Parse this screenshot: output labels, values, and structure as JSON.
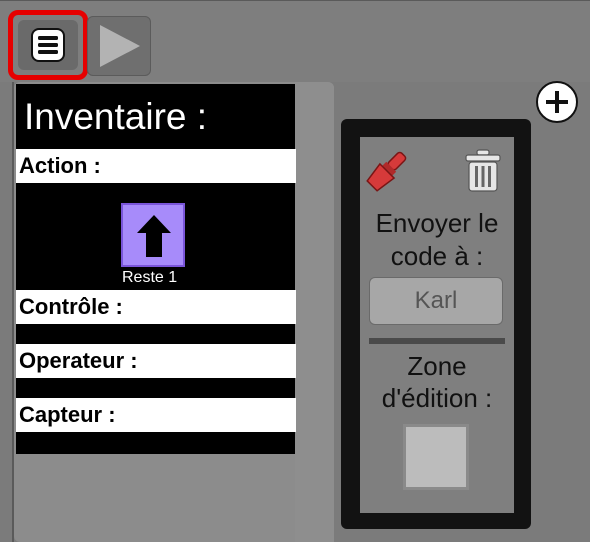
{
  "toolbar": {
    "menu_icon": "list-icon",
    "play_icon": "play-icon",
    "add_icon": "plus-circle-icon",
    "highlight_color": "#e60000"
  },
  "inventory": {
    "title": "Inventaire :",
    "sections": {
      "action": "Action :",
      "controle": "Contrôle :",
      "operateur": "Operateur :",
      "capteur": "Capteur :"
    },
    "block": {
      "icon": "arrow-up-icon",
      "color": "#a78bfa",
      "count_label": "Reste 1"
    }
  },
  "edition_panel": {
    "brush_icon": "paintbrush-icon",
    "trash_icon": "trash-icon",
    "send_label": "Envoyer le code à :",
    "target_value": "Karl",
    "zone_label": "Zone d'édition :",
    "brush_color": "#d63a3a"
  }
}
